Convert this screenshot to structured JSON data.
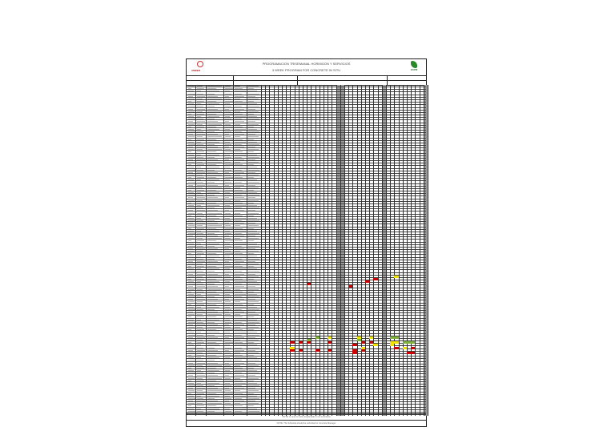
{
  "header": {
    "title": "PROGRAMACION TRISEMANAL HORMIGON Y SERVICIOS",
    "subtitle": "3 WEEK PROGRAM FOR CONCRETE IN SITU",
    "left_logo": "AMBER",
    "right_logo": "ESPM"
  },
  "grid": {
    "row_count": 130,
    "day_columns": 40,
    "shaded_day_columns": [
      19,
      20,
      30,
      40
    ],
    "colors": {
      "red": "#cc0000",
      "yellow": "#f2e200",
      "green": "#7fb23a"
    },
    "highlights": [
      [
        78,
        11,
        "red"
      ],
      [
        79,
        21,
        "red"
      ],
      [
        77,
        25,
        "red"
      ],
      [
        76,
        27,
        "red"
      ],
      [
        75,
        32,
        "yellow"
      ],
      [
        99,
        13,
        "green"
      ],
      [
        99,
        16,
        "yellow"
      ],
      [
        100,
        11,
        "green"
      ],
      [
        101,
        7,
        "red"
      ],
      [
        101,
        9,
        "red"
      ],
      [
        101,
        11,
        "red"
      ],
      [
        101,
        16,
        "red"
      ],
      [
        103,
        7,
        "yellow"
      ],
      [
        104,
        7,
        "red"
      ],
      [
        104,
        9,
        "red"
      ],
      [
        104,
        13,
        "red"
      ],
      [
        104,
        16,
        "red"
      ],
      [
        99,
        23,
        "yellow"
      ],
      [
        100,
        23,
        "green"
      ],
      [
        101,
        24,
        "red"
      ],
      [
        99,
        26,
        "yellow"
      ],
      [
        101,
        26,
        "red"
      ],
      [
        102,
        27,
        "yellow"
      ],
      [
        103,
        24,
        "yellow"
      ],
      [
        102,
        22,
        "red"
      ],
      [
        104,
        22,
        "red"
      ],
      [
        105,
        22,
        "red"
      ],
      [
        104,
        24,
        "red"
      ],
      [
        99,
        31,
        "green"
      ],
      [
        99,
        32,
        "green"
      ],
      [
        101,
        31,
        "yellow"
      ],
      [
        101,
        32,
        "yellow"
      ],
      [
        102,
        31,
        "yellow"
      ],
      [
        101,
        34,
        "green"
      ],
      [
        101,
        35,
        "green"
      ],
      [
        101,
        36,
        "green"
      ],
      [
        103,
        32,
        "red"
      ],
      [
        103,
        34,
        "yellow"
      ],
      [
        105,
        35,
        "red"
      ],
      [
        103,
        36,
        "red"
      ],
      [
        105,
        36,
        "red"
      ]
    ]
  },
  "notes": {
    "note1": "NOTE: Lo que no esta programado no se suministra",
    "note2": "NOTE: The Schedule should be submitted to Concrete Manager"
  }
}
